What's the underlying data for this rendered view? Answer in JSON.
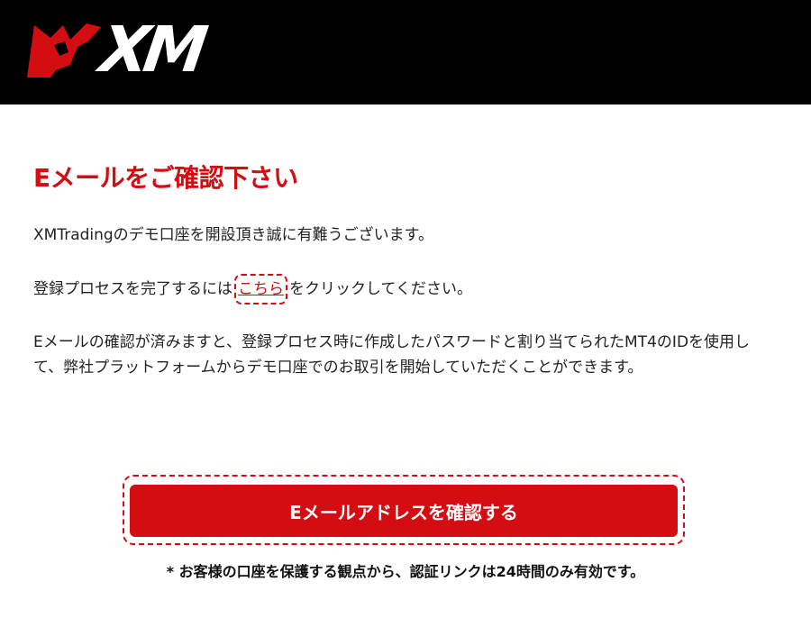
{
  "header": {
    "logo_text": "XM",
    "colors": {
      "background": "#000000",
      "brand_red": "#d40d12"
    }
  },
  "main": {
    "title": "Eメールをご確認下さい",
    "paragraph1": "XMTradingのデモ口座を開設頂き誠に有難うございます。",
    "paragraph2_before": "登録プロセスを完了するには",
    "paragraph2_link": "こちら",
    "paragraph2_after": "をクリックしてください。",
    "paragraph3": "Eメールの確認が済みますと、登録プロセス時に作成したパスワードと割り当てられたMT4のIDを使用して、弊社プラットフォームからデモ口座でのお取引を開始していただくことができます。",
    "confirm_button_label": "Eメールアドレスを確認する",
    "footnote": "* お客様の口座を保護する観点から、認証リンクは24時間のみ有効です。"
  }
}
